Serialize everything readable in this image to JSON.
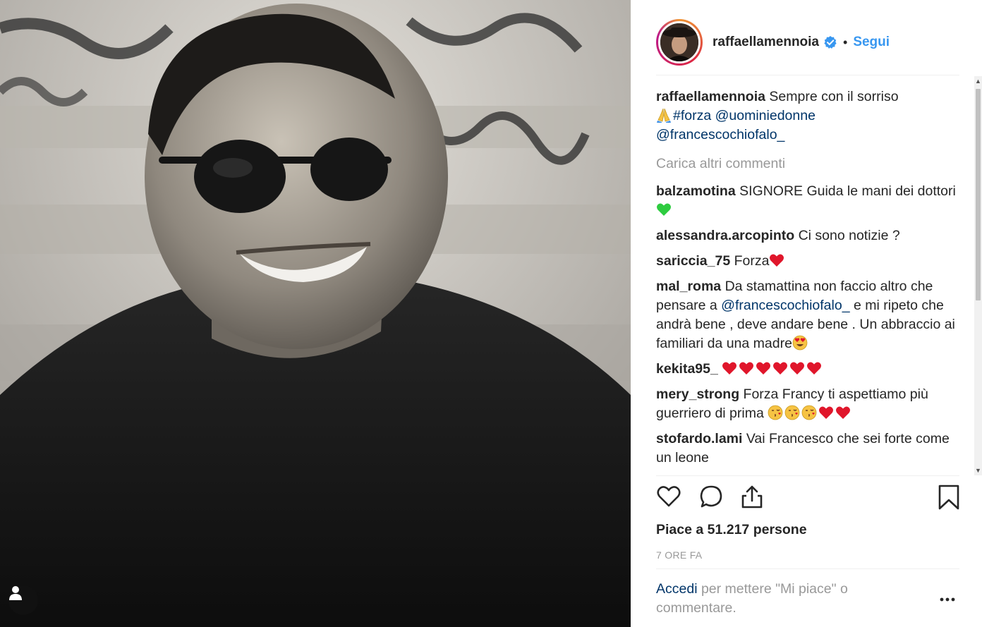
{
  "post": {
    "username": "raffaellamennoia",
    "verified": true,
    "separator": "•",
    "follow_label": "Segui",
    "caption": {
      "username": "raffaellamennoia",
      "text": "Sempre con il sorriso",
      "emoji": "pray-emoji",
      "hashtag": "#forza",
      "mention1": "@uominiedonne",
      "mention2": "@francescochiofalo_"
    },
    "load_more": "Carica altri commenti",
    "comments": [
      {
        "user": "balzamotina",
        "text": "SIGNORE Guida le mani dei dottori"
      },
      {
        "user": "alessandra.arcopinto",
        "text": "Ci sono notizie ?"
      },
      {
        "user": "sariccia_75",
        "text": "Forza"
      },
      {
        "user": "mal_roma",
        "text_a": "Da stamattina non faccio altro che pensare a ",
        "mention": "@francescochiofalo_",
        "text_b": " e mi ripeto che andrà bene , deve andare bene . Un abbraccio ai familiari da una madre"
      },
      {
        "user": "kekita95_",
        "text": ""
      },
      {
        "user": "mery_strong",
        "text": "Forza Francy ti aspettiamo più guerriero di prima"
      },
      {
        "user": "stofardo.lami",
        "text": "Vai Francesco che sei forte come un leone"
      }
    ],
    "likes_text": "Piace a 51.217 persone",
    "time_text": "7 ORE FA",
    "login": {
      "link": "Accedi",
      "text": " per mettere \"Mi piace\" o commentare."
    },
    "colors": {
      "link": "#003569",
      "follow": "#3897f0",
      "muted": "#999999"
    }
  }
}
